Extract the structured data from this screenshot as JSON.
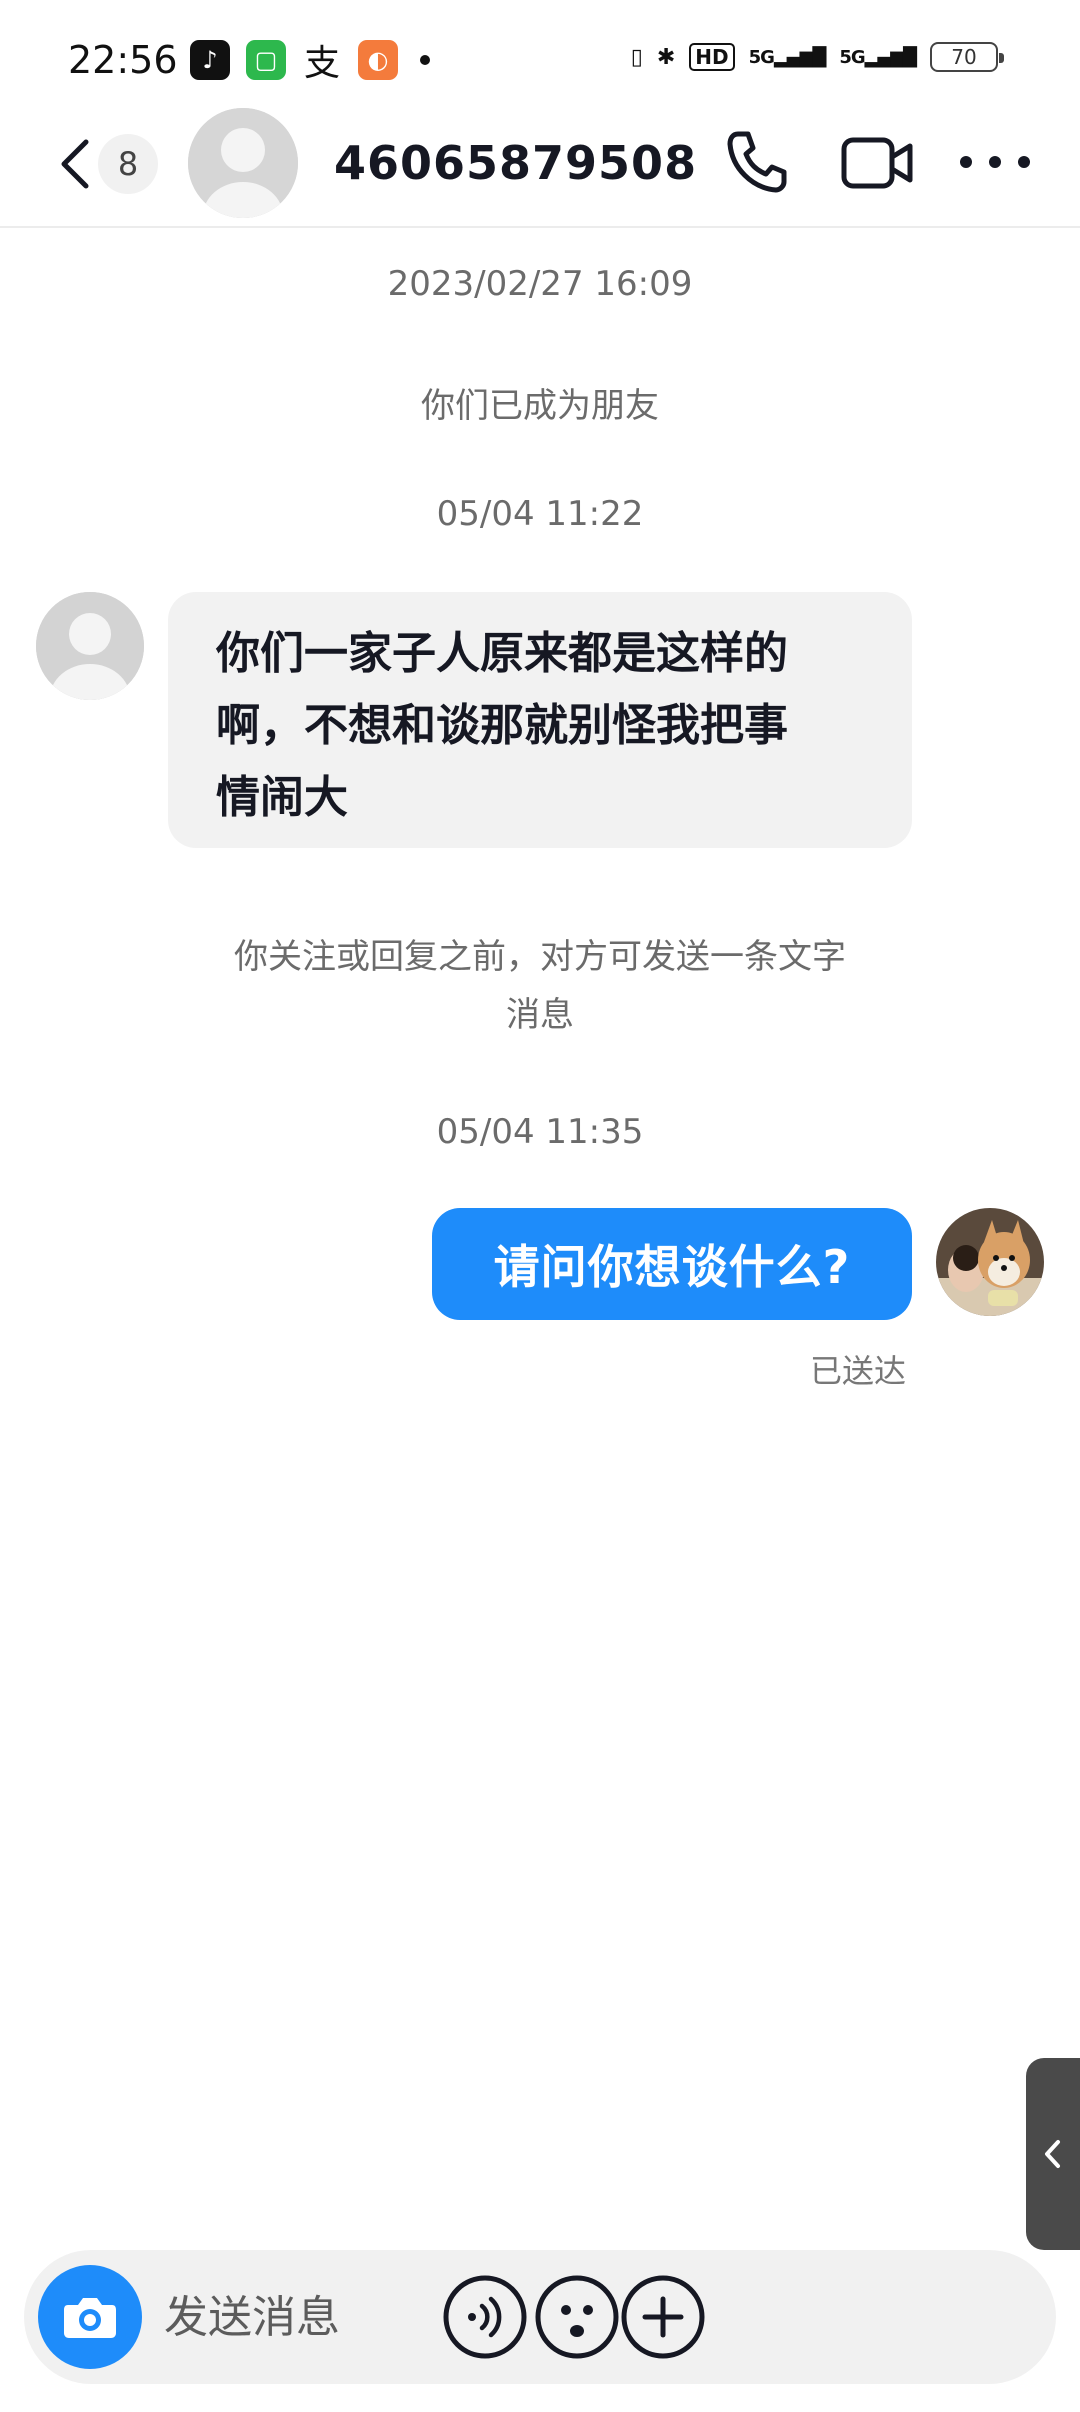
{
  "status_bar": {
    "time": "22:56",
    "app_icons": [
      "tiktok-icon",
      "chat-app-icon",
      "zhi-icon",
      "orange-app-icon"
    ],
    "hd_label": "HD",
    "signal1": "5G",
    "signal2": "5G",
    "battery": "70"
  },
  "header": {
    "unread_count": "8",
    "title": "46065879508",
    "icons": [
      "back-icon",
      "phone-icon",
      "video-icon",
      "more-icon"
    ]
  },
  "chat": {
    "timestamp1": "2023/02/27 16:09",
    "friend_notice": "你们已成为朋友",
    "timestamp2": "05/04 11:22",
    "incoming_message": {
      "line1": "你们一家子人原来都是这样的",
      "line2": "啊，不想和谈那就别怪我把事",
      "line3": "情闹大"
    },
    "limit_notice": {
      "line1": "你关注或回复之前，对方可发送一条文字",
      "line2": "消息"
    },
    "timestamp3": "05/04 11:35",
    "outgoing_message": "请问你想谈什么?",
    "sent_status": "已送达"
  },
  "input_bar": {
    "placeholder": "发送消息",
    "icons": [
      "camera-icon",
      "voice-icon",
      "emoji-icon",
      "plus-icon"
    ]
  },
  "colors": {
    "accent": "#1e8cfa",
    "incoming_bubble": "#f2f2f2",
    "system_text": "#6b6b6b"
  }
}
